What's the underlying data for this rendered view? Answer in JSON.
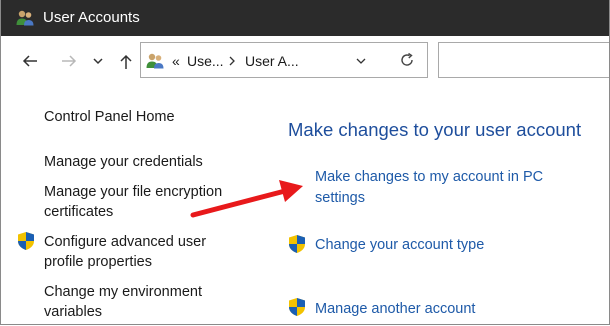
{
  "window": {
    "title": "User Accounts"
  },
  "address_bar": {
    "overflow": "«",
    "crumbs": [
      "Use...",
      "User A..."
    ]
  },
  "left_nav": {
    "control_panel_home": "Control Panel Home",
    "manage_credentials": "Manage your credentials",
    "file_encryption_line1": "Manage your file encryption",
    "file_encryption_line2": "certificates",
    "advanced_profile_line1": "Configure advanced user",
    "advanced_profile_line2": "profile properties",
    "environment_line1": "Change my environment",
    "environment_line2": "variables"
  },
  "main": {
    "heading": "Make changes to your user account",
    "pc_settings_line1": "Make changes to my account in PC",
    "pc_settings_line2": "settings",
    "change_type": "Change your account type",
    "manage_another": "Manage another account"
  },
  "colors": {
    "titlebar": "#2b2b2b",
    "link_blue": "#1e5aa8",
    "heading_blue": "#1e4e9c",
    "arrow_red": "#e8191b"
  },
  "icons": [
    "user-accounts-icon",
    "back-arrow-icon",
    "forward-arrow-icon",
    "chevron-down-icon",
    "up-arrow-icon",
    "chevron-right-icon",
    "dropdown-chevron-icon",
    "refresh-icon",
    "uac-shield-icon",
    "red-annotation-arrow"
  ]
}
